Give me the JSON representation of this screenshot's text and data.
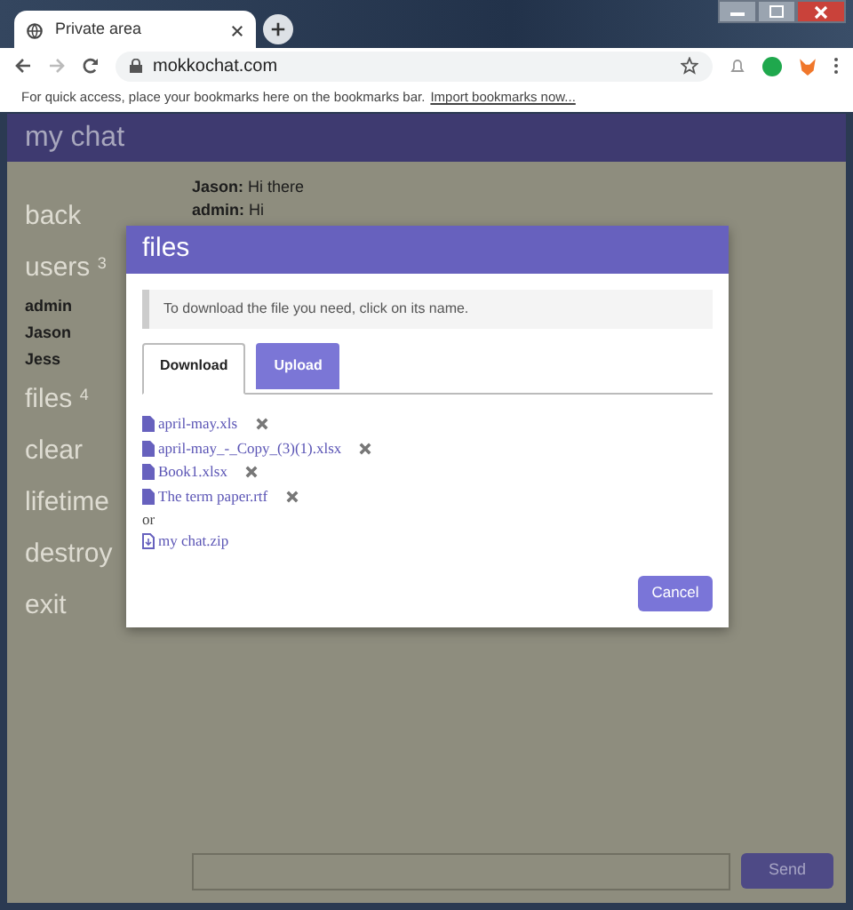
{
  "browser": {
    "tab_title": "Private area",
    "address": "mokkochat.com",
    "bookmarks_hint": "For quick access, place your bookmarks here on the bookmarks bar.",
    "bookmarks_link": "Import bookmarks now..."
  },
  "app": {
    "title": "my chat",
    "sidebar": [
      {
        "kind": "link",
        "label": "back"
      },
      {
        "kind": "link",
        "label": "users",
        "count": "3"
      },
      {
        "kind": "user",
        "label": "admin"
      },
      {
        "kind": "user",
        "label": "Jason"
      },
      {
        "kind": "user",
        "label": "Jess"
      },
      {
        "kind": "link",
        "label": "files",
        "count": "4"
      },
      {
        "kind": "link",
        "label": "clear"
      },
      {
        "kind": "link",
        "label": "lifetime"
      },
      {
        "kind": "link",
        "label": "destroy"
      },
      {
        "kind": "link",
        "label": "exit"
      }
    ],
    "messages": [
      {
        "author": "Jason:",
        "text": "Hi there"
      },
      {
        "author": "admin:",
        "text": "Hi"
      }
    ],
    "send_button": "Send"
  },
  "dialog": {
    "title": "files",
    "hint": "To download the file you need, click on its name.",
    "tabs": [
      {
        "label": "Download",
        "selected": true
      },
      {
        "label": "Upload",
        "selected": false
      }
    ],
    "files": [
      {
        "name": "april-may.xls"
      },
      {
        "name": "april-may_-_Copy_(3)(1).xlsx"
      },
      {
        "name": "Book1.xlsx"
      },
      {
        "name": "The term paper.rtf"
      }
    ],
    "separator": "or",
    "archive": "my chat.zip",
    "cancel": "Cancel"
  }
}
